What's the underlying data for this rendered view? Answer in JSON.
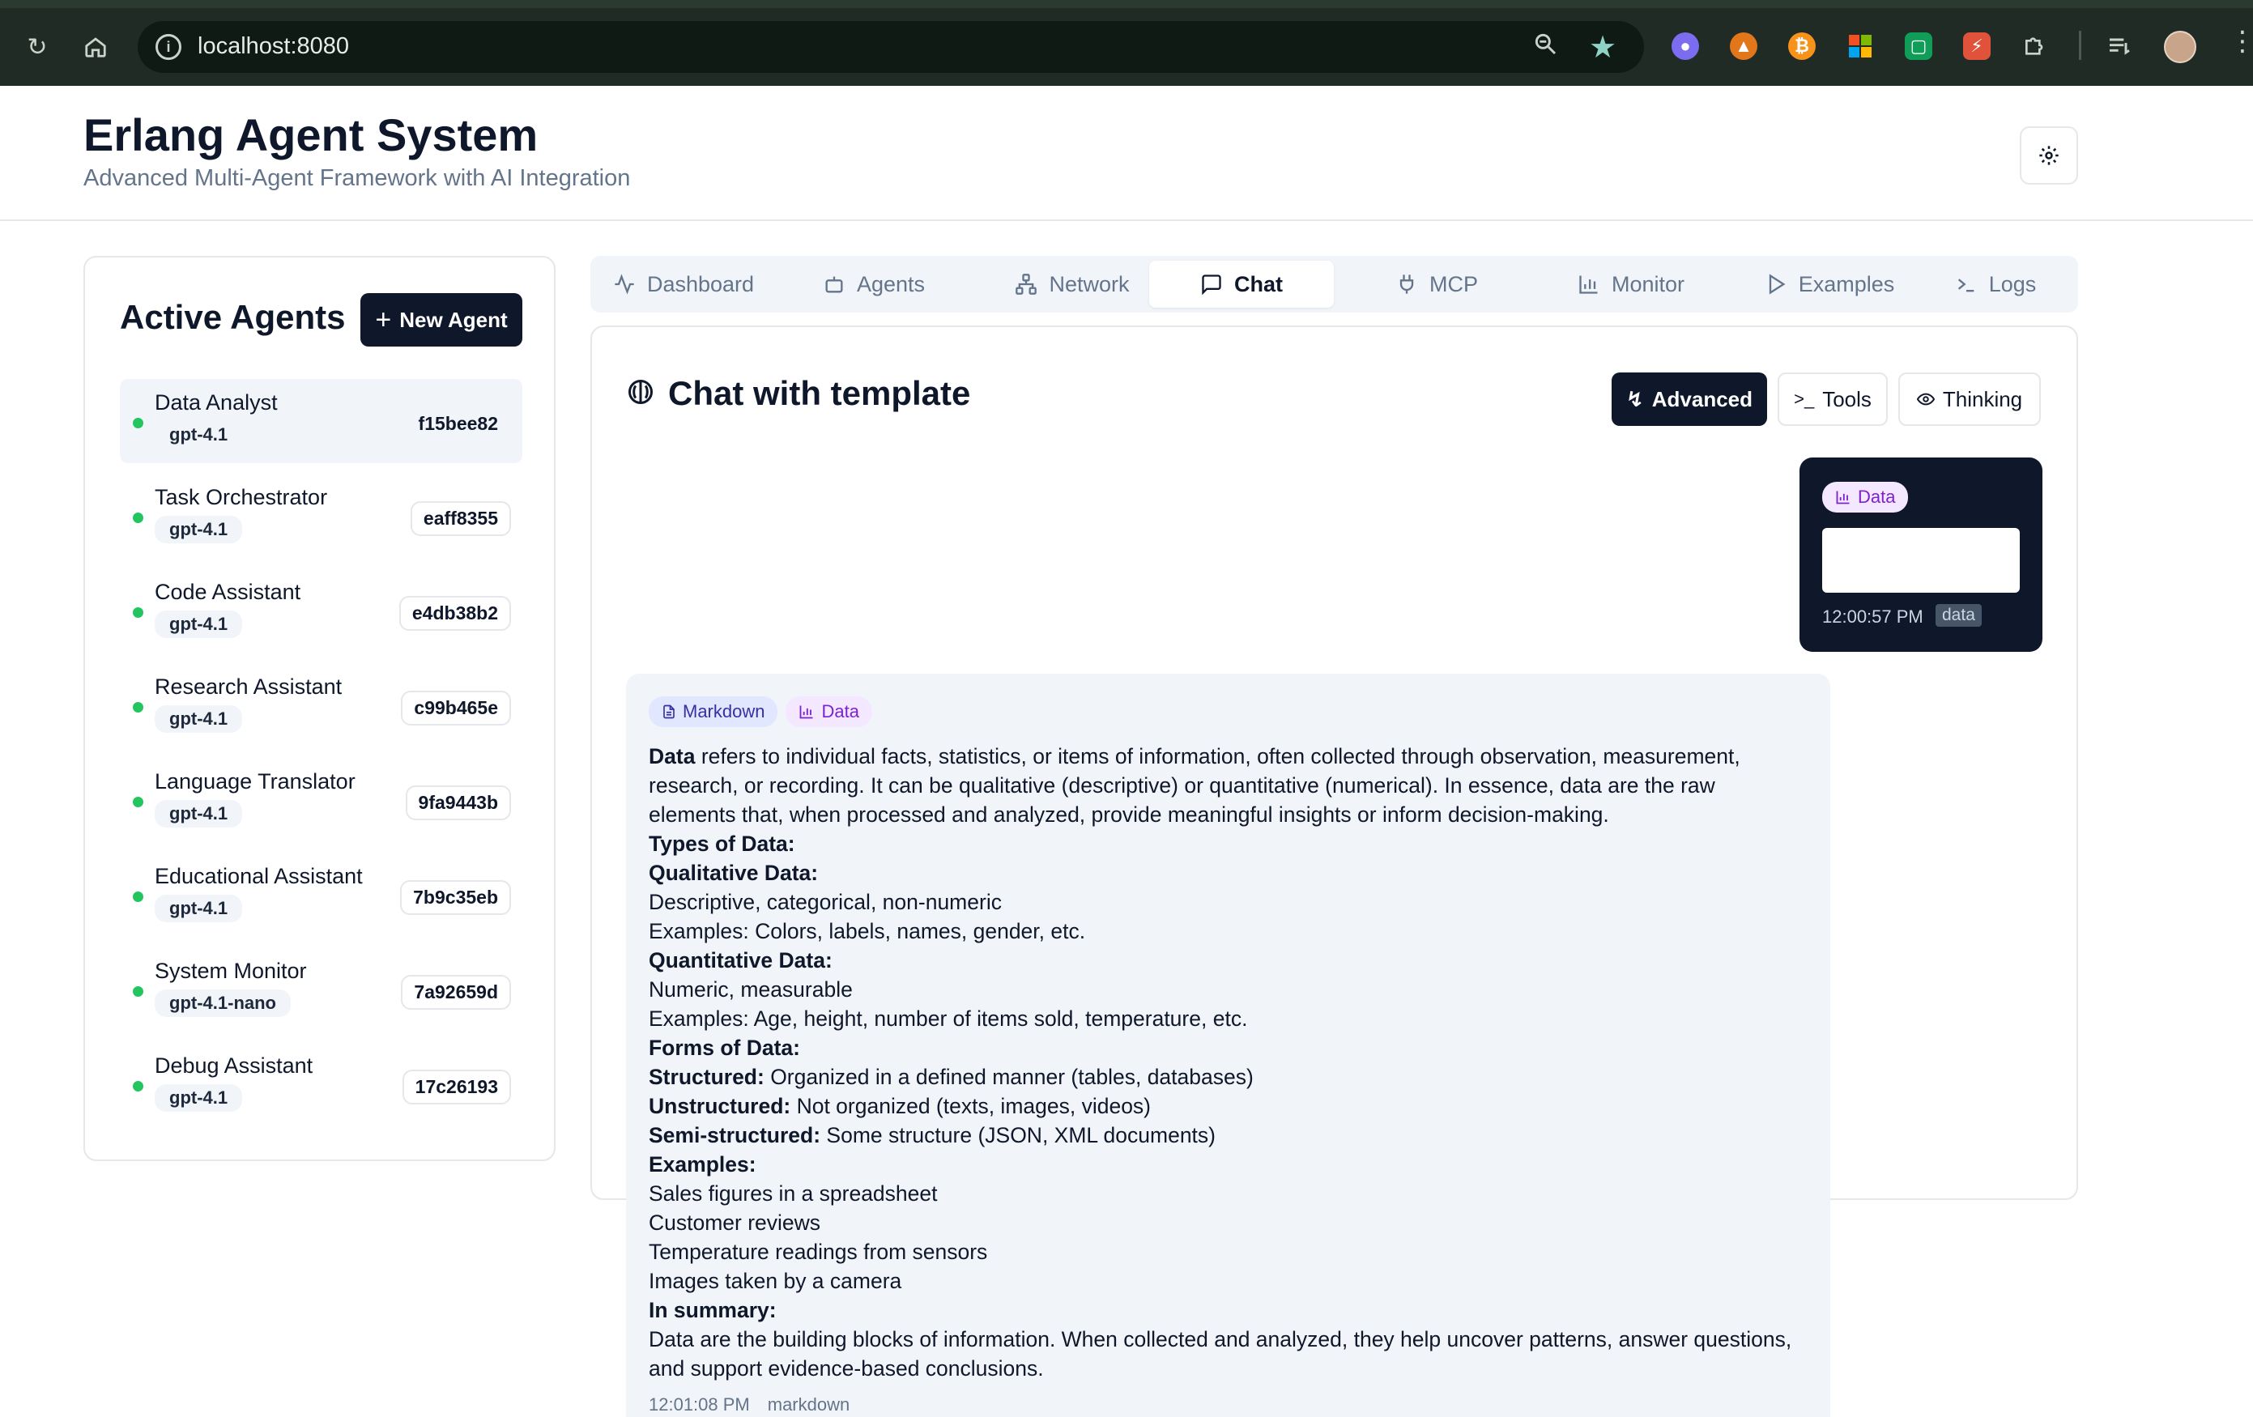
{
  "browser": {
    "url": "localhost:8080",
    "extensions": [
      "ghost-extension",
      "metamask-extension",
      "bitcoin-extension",
      "grid-extension",
      "chat-extension",
      "bolt-extension",
      "puzzle-extension"
    ]
  },
  "header": {
    "title": "Erlang Agent System",
    "subtitle": "Advanced Multi-Agent Framework with AI Integration"
  },
  "sidebar": {
    "title": "Active Agents",
    "new_agent_label": "New Agent",
    "agents": [
      {
        "name": "Data Analyst",
        "model": "gpt-4.1",
        "id": "f15bee82",
        "status_color": "#22c55e"
      },
      {
        "name": "Task Orchestrator",
        "model": "gpt-4.1",
        "id": "eaff8355",
        "status_color": "#22c55e"
      },
      {
        "name": "Code Assistant",
        "model": "gpt-4.1",
        "id": "e4db38b2",
        "status_color": "#22c55e"
      },
      {
        "name": "Research Assistant",
        "model": "gpt-4.1",
        "id": "c99b465e",
        "status_color": "#22c55e"
      },
      {
        "name": "Language Translator",
        "model": "gpt-4.1",
        "id": "9fa9443b",
        "status_color": "#22c55e"
      },
      {
        "name": "Educational Assistant",
        "model": "gpt-4.1",
        "id": "7b9c35eb",
        "status_color": "#22c55e"
      },
      {
        "name": "System Monitor",
        "model": "gpt-4.1-nano",
        "id": "7a92659d",
        "status_color": "#22c55e"
      },
      {
        "name": "Debug Assistant",
        "model": "gpt-4.1",
        "id": "17c26193",
        "status_color": "#22c55e"
      }
    ]
  },
  "tabs": [
    {
      "label": "Dashboard",
      "icon": "activity-icon"
    },
    {
      "label": "Agents",
      "icon": "bot-icon"
    },
    {
      "label": "Network",
      "icon": "network-icon"
    },
    {
      "label": "Chat",
      "icon": "message-square-icon",
      "active": true
    },
    {
      "label": "MCP",
      "icon": "plug-icon"
    },
    {
      "label": "Monitor",
      "icon": "bar-chart-icon"
    },
    {
      "label": "Examples",
      "icon": "play-icon"
    },
    {
      "label": "Logs",
      "icon": "terminal-icon"
    }
  ],
  "chat": {
    "title": "Chat with template",
    "advanced_label": "Advanced",
    "tools_label": "Tools",
    "thinking_label": "Thinking",
    "user_message": {
      "badge": "Data",
      "time": "12:00:57 PM",
      "type": "data"
    },
    "assistant_message": {
      "badges": [
        "Markdown",
        "Data"
      ],
      "intro_bold": "Data",
      "intro_rest": " refers to individual facts, statistics, or items of information, often collected through observation, measurement, research, or recording. It can be qualitative (descriptive) or quantitative (numerical). In essence, data are the raw elements that, when processed and analyzed, provide meaningful insights or inform decision-making.",
      "types_heading": "Types of Data:",
      "qualitative_heading": "Qualitative Data:",
      "qualitative_line1": "Descriptive, categorical, non-numeric",
      "qualitative_line2": "Examples: Colors, labels, names, gender, etc.",
      "quantitative_heading": "Quantitative Data:",
      "quantitative_line1": "Numeric, measurable",
      "quantitative_line2": "Examples: Age, height, number of items sold, temperature, etc.",
      "forms_heading": "Forms of Data:",
      "structured_bold": "Structured:",
      "structured_rest": " Organized in a defined manner (tables, databases)",
      "unstructured_bold": "Unstructured:",
      "unstructured_rest": " Not organized (texts, images, videos)",
      "semi_bold": "Semi-structured:",
      "semi_rest": " Some structure (JSON, XML documents)",
      "examples_heading": "Examples:",
      "examples": [
        "Sales figures in a spreadsheet",
        "Customer reviews",
        "Temperature readings from sensors",
        "Images taken by a camera"
      ],
      "summary_heading": "In summary:",
      "summary_text": "Data are the building blocks of information. When collected and analyzed, they help uncover patterns, answer questions, and support evidence-based conclusions.",
      "time": "12:01:08 PM",
      "type": "markdown"
    }
  }
}
